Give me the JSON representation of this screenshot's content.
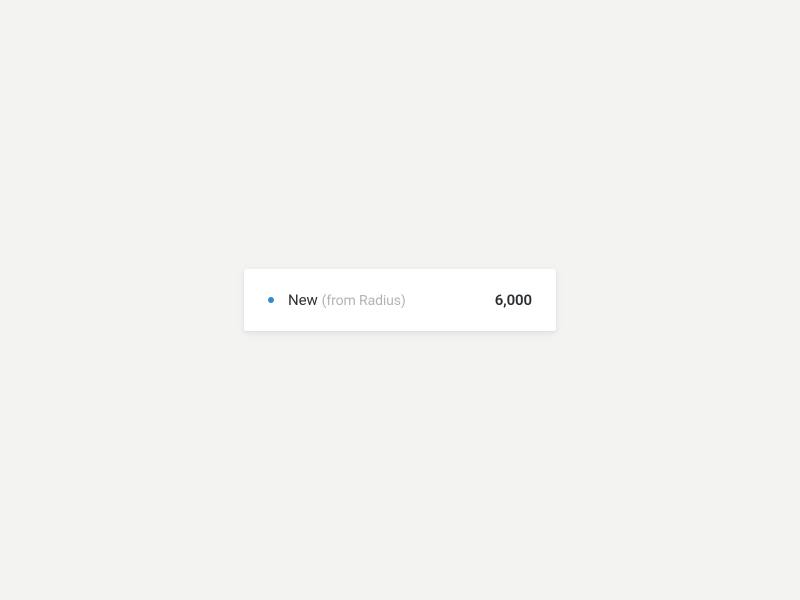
{
  "metric": {
    "dot_color": "#2b8ec9",
    "label": "New",
    "sub_label": "(from Radius)",
    "value": "6,000"
  }
}
